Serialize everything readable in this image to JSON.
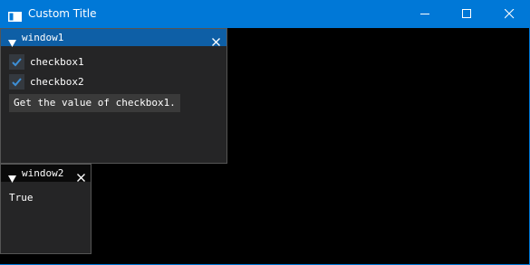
{
  "window": {
    "title": "Custom Title"
  },
  "window1": {
    "title": "window1",
    "checkboxes": [
      {
        "label": "checkbox1",
        "checked": true
      },
      {
        "label": "checkbox2",
        "checked": true
      }
    ],
    "button_label": "Get the value of checkbox1."
  },
  "window2": {
    "title": "window2",
    "result_text": "True"
  },
  "colors": {
    "titlebar": "#0078d7",
    "window1_header": "#0e5fa6",
    "check_accent": "#3d8fd6"
  }
}
